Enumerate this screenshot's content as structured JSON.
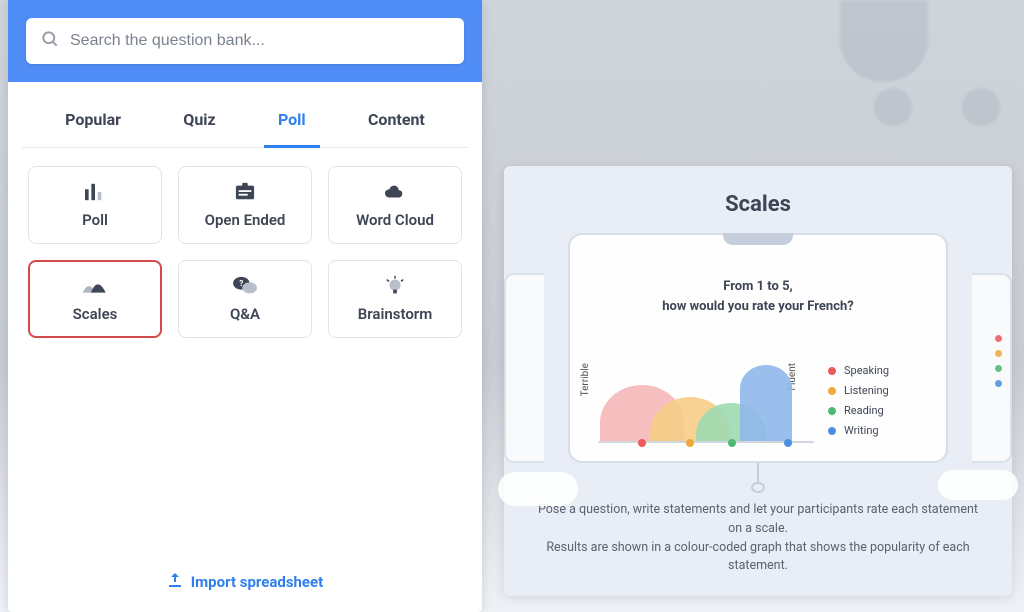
{
  "search": {
    "placeholder": "Search the question bank..."
  },
  "tabs": [
    {
      "label": "Popular",
      "active": false
    },
    {
      "label": "Quiz",
      "active": false
    },
    {
      "label": "Poll",
      "active": true
    },
    {
      "label": "Content",
      "active": false
    }
  ],
  "cards": [
    {
      "label": "Poll",
      "icon": "poll-icon",
      "selected": false
    },
    {
      "label": "Open Ended",
      "icon": "open-ended-icon",
      "selected": false
    },
    {
      "label": "Word Cloud",
      "icon": "cloud-icon",
      "selected": false
    },
    {
      "label": "Scales",
      "icon": "scales-icon",
      "selected": true
    },
    {
      "label": "Q&A",
      "icon": "qa-icon",
      "selected": false
    },
    {
      "label": "Brainstorm",
      "icon": "brainstorm-icon",
      "selected": false
    }
  ],
  "import_label": "Import spreadsheet",
  "preview": {
    "title": "Scales",
    "heading_line1": "From 1 to 5,",
    "heading_line2": "how would you rate your French?",
    "ylabel_low": "Terrible",
    "ylabel_high": "Fluent",
    "legend": [
      {
        "name": "Speaking",
        "color": "#ee5a5a"
      },
      {
        "name": "Listening",
        "color": "#f2a93c"
      },
      {
        "name": "Reading",
        "color": "#4fb873"
      },
      {
        "name": "Writing",
        "color": "#4a90e2"
      }
    ],
    "desc_line1": "Pose a question, write statements and let your participants rate each statement on a scale.",
    "desc_line2": "Results are shown in a colour-coded graph that shows the popularity of each statement."
  },
  "chart_data": {
    "type": "area",
    "title": "From 1 to 5, how would you rate your French?",
    "xlabel": "",
    "ylabel_left": "Terrible",
    "ylabel_right": "Fluent",
    "x_range": [
      1,
      5
    ],
    "series": [
      {
        "name": "Speaking",
        "color": "#ee5a5a",
        "peak_x": 1.7,
        "peak_height": 0.7,
        "width": 1.6
      },
      {
        "name": "Listening",
        "color": "#f2a93c",
        "peak_x": 2.7,
        "peak_height": 0.55,
        "width": 1.6
      },
      {
        "name": "Reading",
        "color": "#4fb873",
        "peak_x": 3.5,
        "peak_height": 0.48,
        "width": 1.4
      },
      {
        "name": "Writing",
        "color": "#4a90e2",
        "peak_x": 4.3,
        "peak_height": 0.95,
        "width": 1.0
      }
    ]
  }
}
